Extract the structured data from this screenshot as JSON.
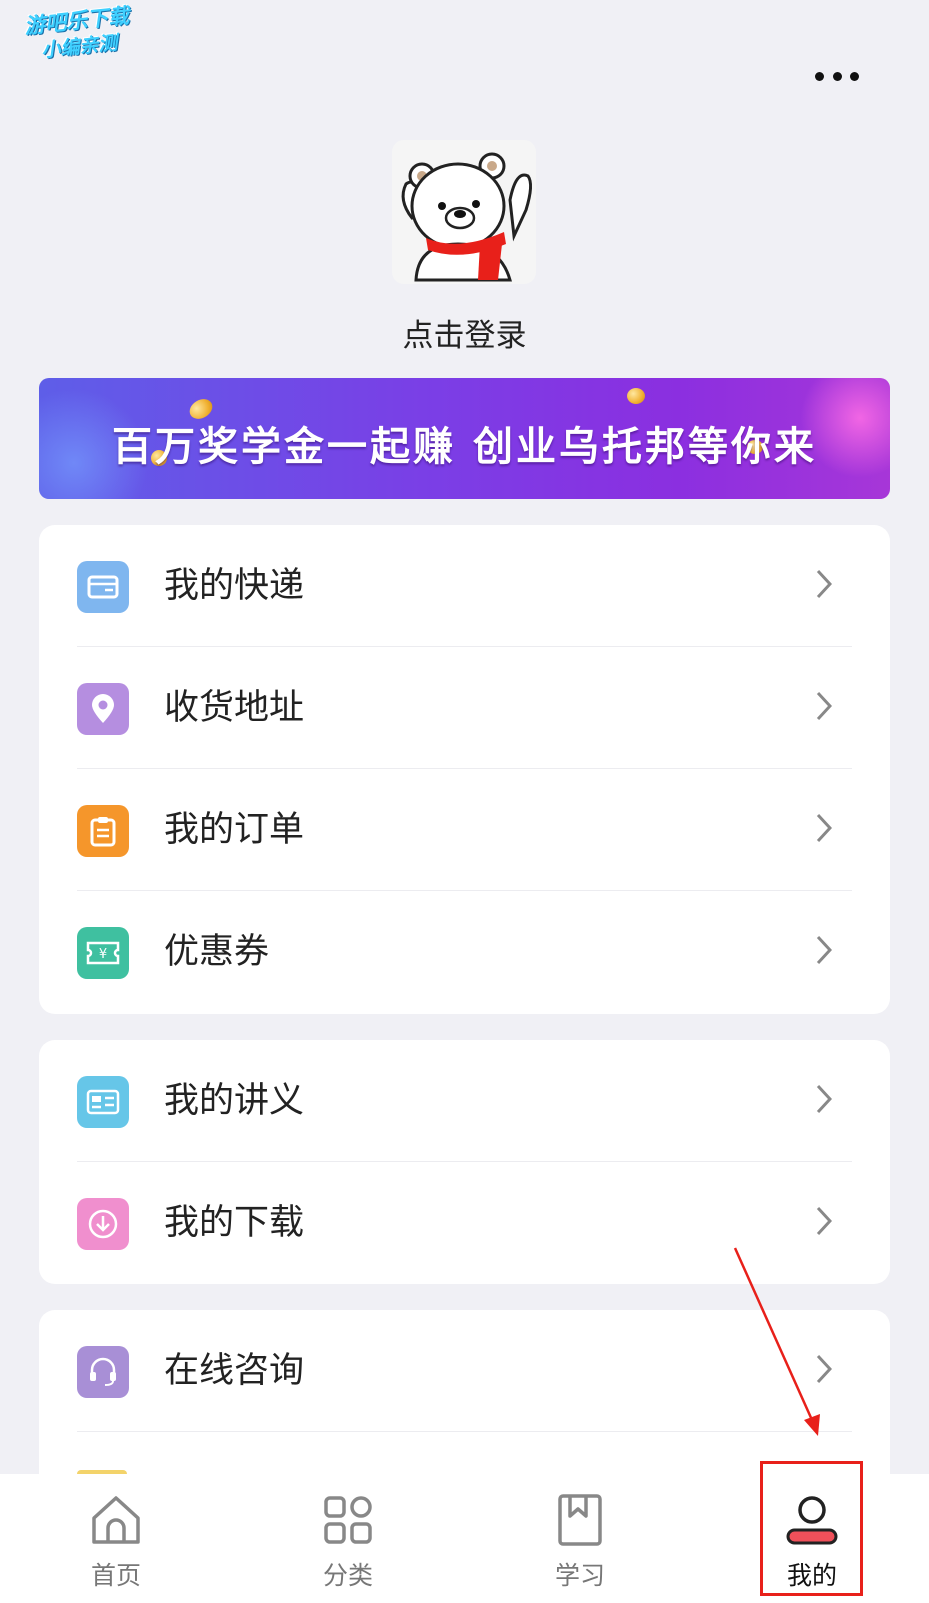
{
  "watermark": {
    "line1": "游吧乐下载",
    "line2": "小编亲测"
  },
  "header": {
    "more_icon": "more-dots-icon"
  },
  "profile": {
    "avatar_icon": "polar-bear-avatar-icon",
    "login_label": "点击登录"
  },
  "banner": {
    "text": "百万奖学金一起赚  创业乌托邦等你来"
  },
  "menu_group1": {
    "items": [
      {
        "label": "我的快递",
        "icon": "express-box-icon",
        "color": "#7fb6ef"
      },
      {
        "label": "收货地址",
        "icon": "location-pin-icon",
        "color": "#b58ee0"
      },
      {
        "label": "我的订单",
        "icon": "order-clipboard-icon",
        "color": "#f5962b"
      },
      {
        "label": "优惠券",
        "icon": "coupon-icon",
        "color": "#3fc0a0"
      }
    ]
  },
  "menu_group2": {
    "items": [
      {
        "label": "我的讲义",
        "icon": "handout-book-icon",
        "color": "#66c6e8"
      },
      {
        "label": "我的下载",
        "icon": "download-icon",
        "color": "#f08fce"
      }
    ]
  },
  "menu_group3": {
    "items": [
      {
        "label": "在线咨询",
        "icon": "headset-icon",
        "color": "#a88fd6"
      }
    ]
  },
  "tabbar": {
    "tabs": [
      {
        "label": "首页",
        "icon": "home-icon"
      },
      {
        "label": "分类",
        "icon": "category-grid-icon"
      },
      {
        "label": "学习",
        "icon": "study-bookmark-icon"
      },
      {
        "label": "我的",
        "icon": "profile-icon",
        "active": true
      }
    ]
  },
  "colors": {
    "accent_red": "#e8201a",
    "background": "#f0f0f5"
  }
}
